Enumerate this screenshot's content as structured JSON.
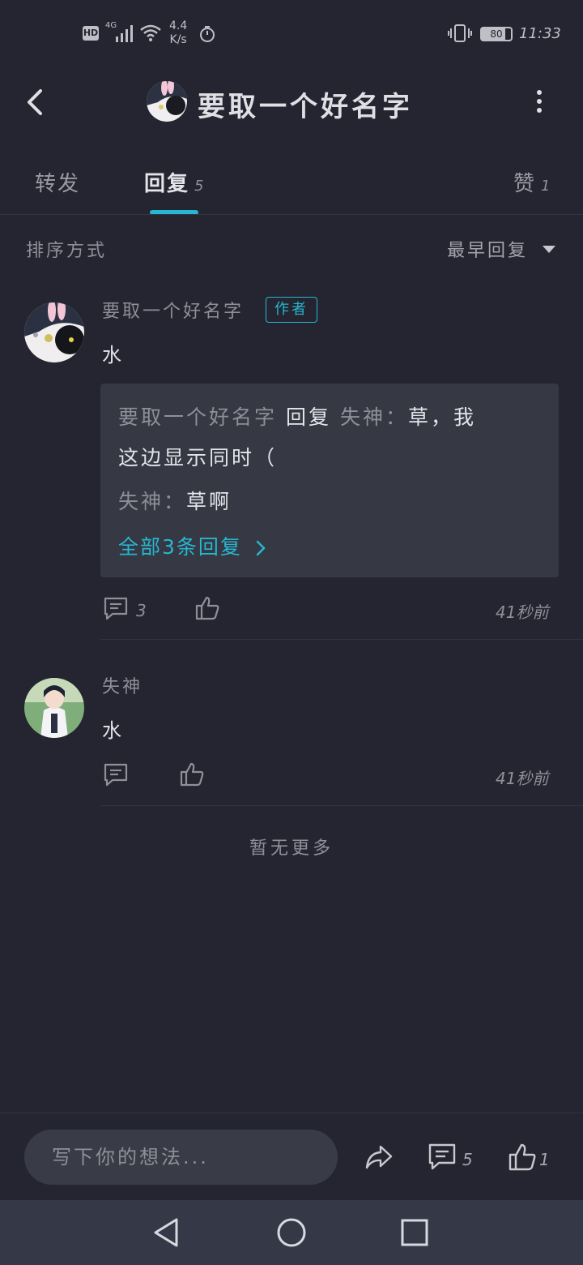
{
  "status_bar": {
    "hd": "HD",
    "network": "4G",
    "speed_value": "4.4",
    "speed_unit": "K/s",
    "battery": "80",
    "time": "11:33"
  },
  "header": {
    "title": "要取一个好名字"
  },
  "tabs": [
    {
      "label": "转发",
      "count": ""
    },
    {
      "label": "回复",
      "count": "5"
    },
    {
      "label": "赞",
      "count": "1"
    }
  ],
  "sort": {
    "label": "排序方式",
    "value": "最早回复"
  },
  "comments": [
    {
      "name": "要取一个好名字",
      "badge": "作者",
      "text": "水",
      "replies": {
        "line1_name": "要取一个好名字",
        "line1_action": "回复",
        "line1_target": "失神：",
        "line1_text": "草，我",
        "line2_text": "这边显示同时（",
        "line3_name": "失神：",
        "line3_text": "草啊",
        "see_all": "全部3条回复"
      },
      "comment_count": "3",
      "time": "41秒前"
    },
    {
      "name": "失神",
      "text": "水",
      "time": "41秒前"
    }
  ],
  "no_more": "暂无更多",
  "bottom_bar": {
    "input_placeholder": "写下你的想法...",
    "comment_count": "5",
    "like_count": "1"
  }
}
